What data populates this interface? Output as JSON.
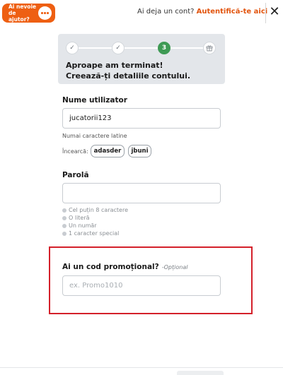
{
  "header": {
    "help_label": "Ai nevoie de ajutor?",
    "account_question": "Ai deja un cont?",
    "login_link": "Autentifică-te aici",
    "close_symbol": "✕"
  },
  "progress": {
    "steps": [
      {
        "label": "✓",
        "state": "done"
      },
      {
        "label": "✓",
        "state": "done"
      },
      {
        "label": "3",
        "state": "active"
      },
      {
        "label": "gift-icon",
        "state": "pending"
      }
    ],
    "title_line1": "Aproape am terminat!",
    "title_line2": "Creează-ți detaliile contului."
  },
  "username": {
    "label": "Nume utilizator",
    "value": "jucatorii123",
    "hint": "Numai caractere latine",
    "suggest_label": "Încearcă:",
    "suggestions": [
      "adasder",
      "jbuni"
    ]
  },
  "password": {
    "label": "Parolă",
    "value": "",
    "rules": [
      "Cel puțin 8 caractere",
      "O literă",
      "Un număr",
      "1 caracter special"
    ]
  },
  "promo": {
    "label": "Ai un cod promoțional?",
    "optional": "-Opțional",
    "placeholder": "ex. Promo1010"
  },
  "colors": {
    "brand_orange": "#ee5f12",
    "active_step_green": "#3e9a54",
    "highlight_red": "#d4202a"
  }
}
